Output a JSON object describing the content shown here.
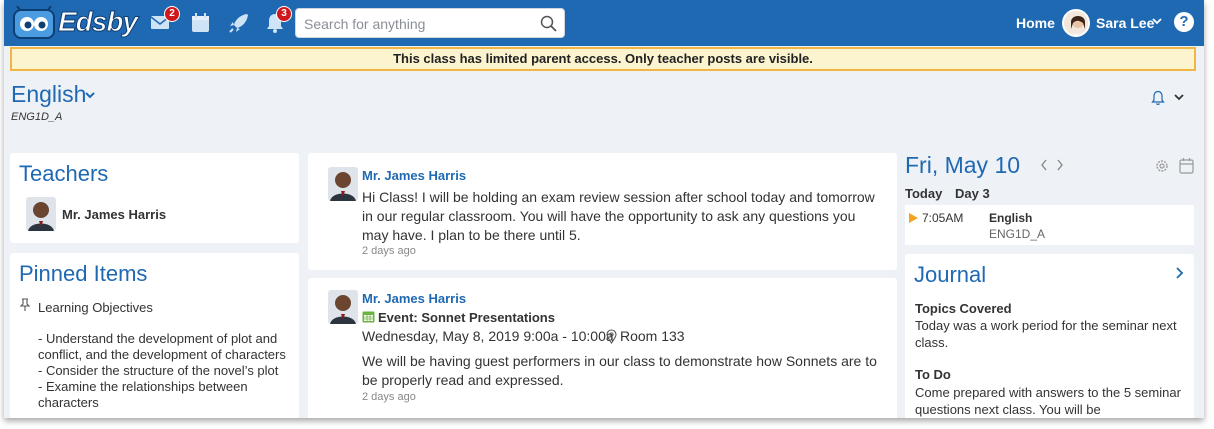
{
  "topbar": {
    "logo_text": "Edsby",
    "messages_badge": "2",
    "notifications_badge": "3",
    "search_placeholder": "Search for anything",
    "home_label": "Home",
    "user_name": "Sara Lee",
    "help_label": "?",
    "colors": {
      "bar": "#1f69b3",
      "badge": "#d0181c"
    }
  },
  "banner": {
    "text": "This class has limited parent access. Only teacher posts are visible."
  },
  "class": {
    "title": "English",
    "code": "ENG1D_A"
  },
  "teachers": {
    "title": "Teachers",
    "items": [
      {
        "name": "Mr. James Harris"
      }
    ]
  },
  "pinned": {
    "title": "Pinned Items",
    "item_label": "Learning Objectives",
    "objectives": [
      "- Understand the development of plot and conflict, and the development of characters",
      "- Consider the structure of the novel’s plot",
      "- Examine the relationships between characters"
    ]
  },
  "posts": [
    {
      "author": "Mr. James Harris",
      "body": "Hi Class! I will be holding an exam review session after school today and tomorrow in our regular classroom. You will have the opportunity to ask any questions you may have. I plan to be there until 5.",
      "time": "2 days ago"
    },
    {
      "author": "Mr. James Harris",
      "event_title": "Event:  Sonnet Presentations",
      "event_date": "Wednesday, May 8, 2019 9:00a - 10:00a",
      "event_location": "Room 133",
      "body": "We will be having guest performers in our class to demonstrate how Sonnets are to be properly read and expressed.",
      "time": "2 days ago"
    }
  ],
  "day": {
    "title": "Fri, May 10",
    "today_label": "Today",
    "day_label": "Day 3",
    "schedule": [
      {
        "time": "7:05AM",
        "class": "English",
        "code": "ENG1D_A"
      }
    ]
  },
  "journal": {
    "title": "Journal",
    "topics_head": "Topics Covered",
    "topics_body": "Today was a work period for the seminar next class.",
    "todo_head": "To Do",
    "todo_body": "Come prepared with answers to the 5 seminar questions next class. You will be"
  }
}
